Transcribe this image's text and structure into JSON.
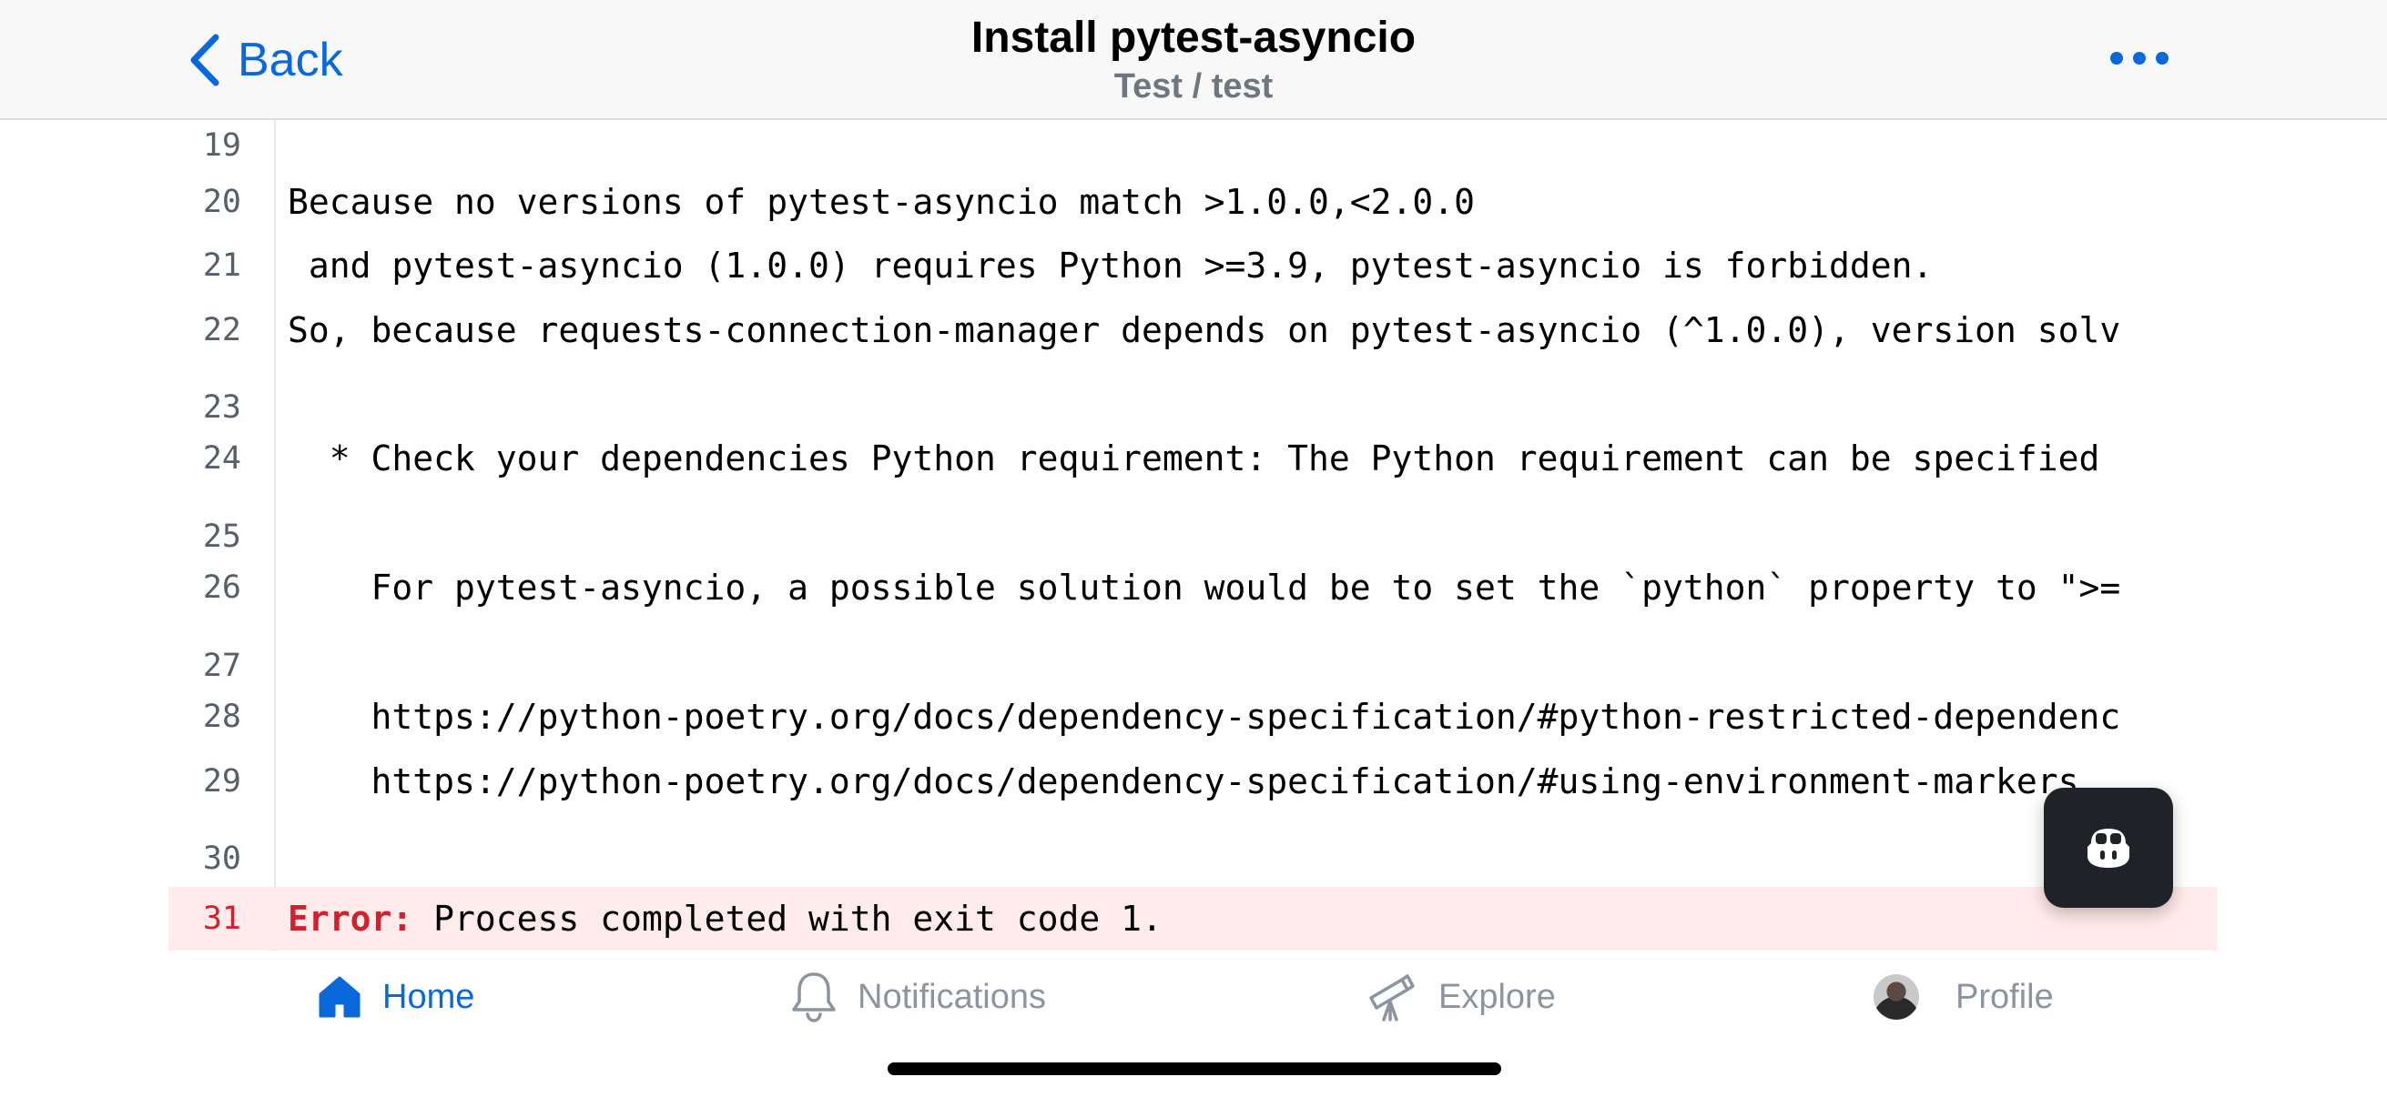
{
  "header": {
    "back_label": "Back",
    "title": "Install pytest-asyncio",
    "subtitle": "Test / test"
  },
  "log": {
    "lines": [
      {
        "num": "19",
        "text": ""
      },
      {
        "num": "20",
        "text": "Because no versions of pytest-asyncio match >1.0.0,<2.0.0"
      },
      {
        "num": "21",
        "text": " and pytest-asyncio (1.0.0) requires Python >=3.9, pytest-asyncio is forbidden."
      },
      {
        "num": "22",
        "text": "So, because requests-connection-manager depends on pytest-asyncio (^1.0.0), version solv"
      },
      {
        "num": "23",
        "text": ""
      },
      {
        "num": "24",
        "text": "  * Check your dependencies Python requirement: The Python requirement can be specified"
      },
      {
        "num": "25",
        "text": ""
      },
      {
        "num": "26",
        "text": "    For pytest-asyncio, a possible solution would be to set the `python` property to \">="
      },
      {
        "num": "27",
        "text": ""
      },
      {
        "num": "28",
        "text": "    https://python-poetry.org/docs/dependency-specification/#python-restricted-dependenc"
      },
      {
        "num": "29",
        "text": "    https://python-poetry.org/docs/dependency-specification/#using-environment-markers"
      },
      {
        "num": "30",
        "text": ""
      }
    ],
    "error_line": {
      "num": "31",
      "prefix": "Error:",
      "text": " Process completed with exit code 1."
    }
  },
  "tabs": {
    "home": "Home",
    "notifications": "Notifications",
    "explore": "Explore",
    "profile": "Profile"
  },
  "colors": {
    "accent": "#0969da",
    "error": "#cf222e",
    "error_bg": "#ffebe9"
  }
}
